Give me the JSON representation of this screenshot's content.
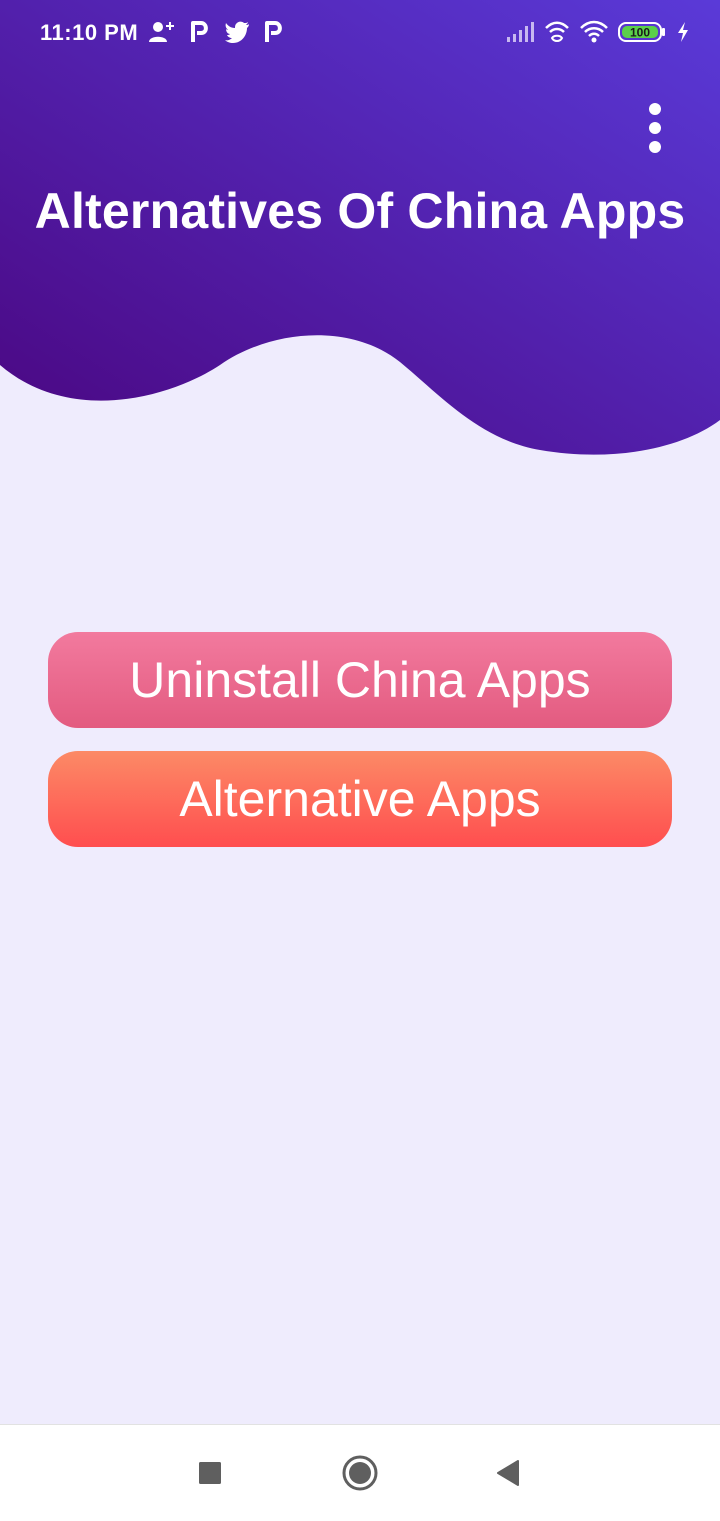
{
  "status_bar": {
    "time": "11:10 PM",
    "battery": "100",
    "left_icons": [
      "person-add-icon",
      "p-app-icon",
      "twitter-icon",
      "p-app-icon"
    ],
    "right_icons": [
      "signal-icon",
      "wifi-calling-icon",
      "wifi-icon",
      "battery-icon",
      "charging-icon"
    ]
  },
  "app": {
    "title": "Alternatives Of China Apps",
    "menu_icon": "more-vert-icon"
  },
  "buttons": {
    "uninstall_label": "Uninstall China Apps",
    "alternative_label": "Alternative Apps"
  },
  "nav_bar": {
    "recents_icon": "square-icon",
    "home_icon": "circle-icon",
    "back_icon": "triangle-back-icon"
  },
  "colors": {
    "header_start": "#4a0680",
    "header_end": "#5636d6",
    "background": "#efecfd",
    "uninstall_button": "#ec6b8f",
    "alternative_button": "#ff6a58"
  }
}
